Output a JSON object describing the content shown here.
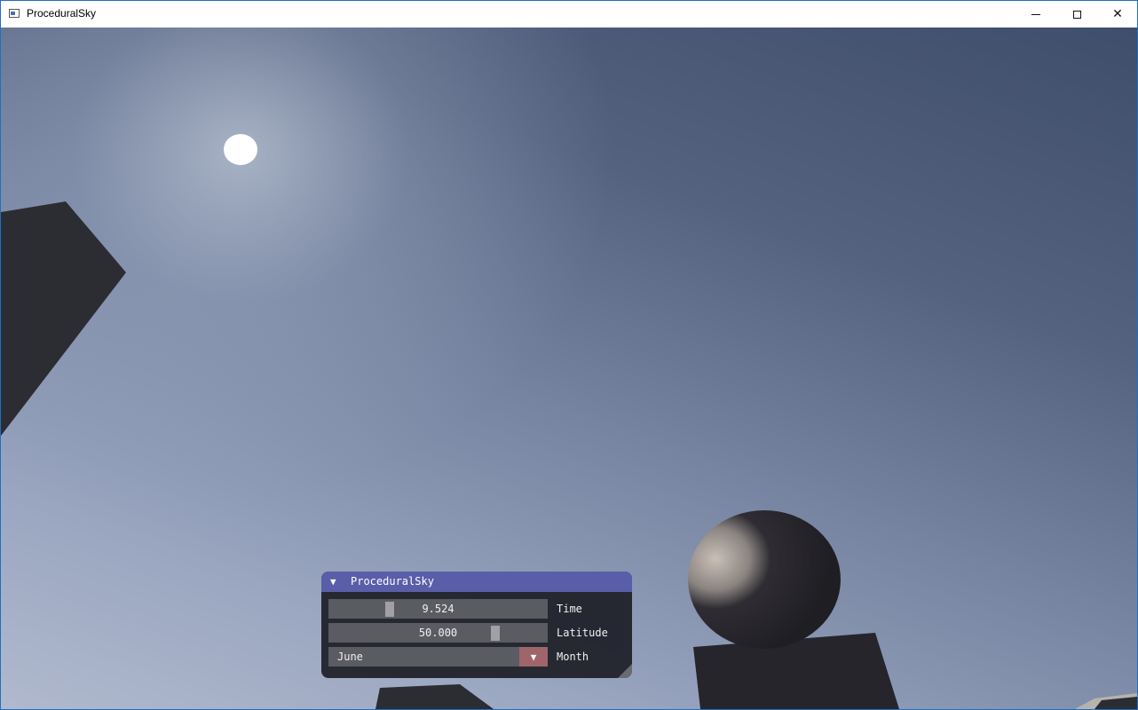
{
  "window": {
    "title": "ProceduralSky",
    "controls": {
      "minimize_icon": "minimize-icon",
      "maximize_icon": "maximize-icon",
      "close_icon": "close-icon",
      "close_glyph": "✕"
    }
  },
  "scene": {
    "sky_colors": {
      "zenith": "#3f4e6b",
      "horizon": "#b0b9cd",
      "sun_glow": "#bec8d7",
      "sun": "#ffffff"
    },
    "object_color": "#2c2c33"
  },
  "panel": {
    "title": "ProceduralSky",
    "collapse_glyph": "▼",
    "header_color": "#5a5ea8",
    "time": {
      "label": "Time",
      "value": "9.524"
    },
    "latitude": {
      "label": "Latitude",
      "value": "50.000"
    },
    "month": {
      "label": "Month",
      "value": "June",
      "arrow_glyph": "▼"
    }
  }
}
